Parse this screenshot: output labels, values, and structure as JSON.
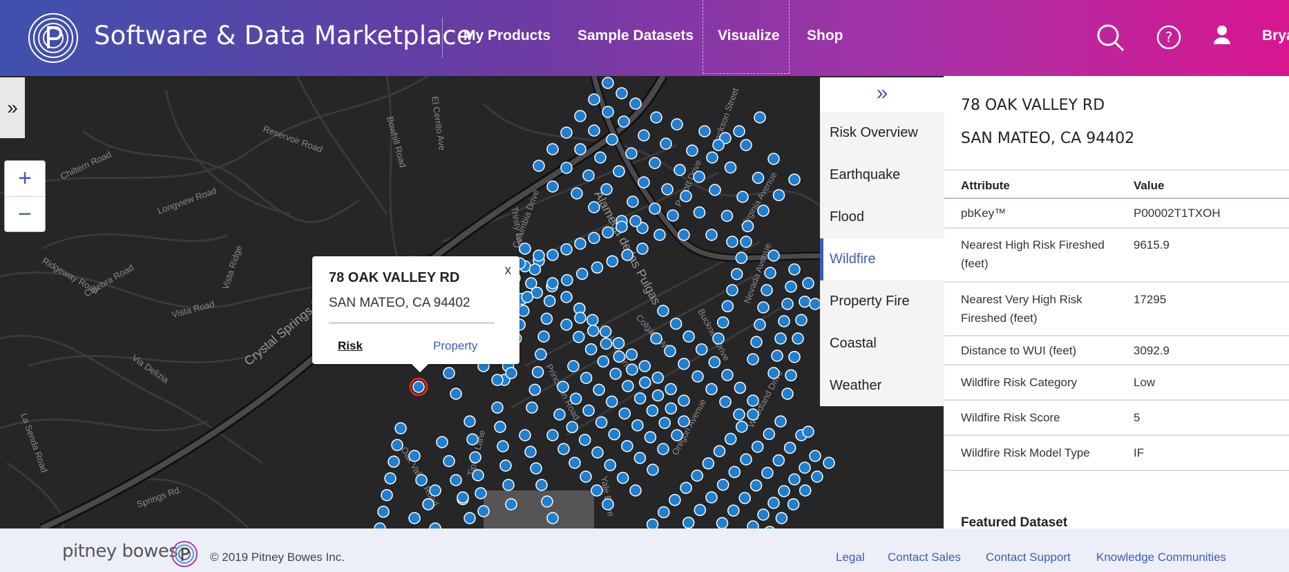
{
  "header": {
    "brand": "Software & Data Marketplace",
    "nav": [
      "My Products",
      "Sample Datasets",
      "Visualize",
      "Shop"
    ],
    "active_nav": "Visualize",
    "user": "Bryan"
  },
  "map": {
    "street_labels": [
      "Crystal Springs Rd.",
      "Alameda de las Pulgas",
      "Reservoir Road",
      "Chiltern Road",
      "Longview Road",
      "Ridgeway Road",
      "Culebra Road",
      "Vista Road",
      "Via Delizia",
      "La Senda Road",
      "Bowhill Road",
      "El Cerrito Ave",
      "Parrott Drive",
      "Virginia Avenue",
      "Jackson Street",
      "Columbia Drive",
      "Colgate Way",
      "Iowa Drive",
      "Princeton Road",
      "Yale Drive",
      "Oregon Avenue",
      "Woodland Drive",
      "Nevada Avenue",
      "Bucknell Drive",
      "Oak Valley Road",
      "Tiptoe Lane",
      "Vista Ridge",
      "Trinity Lane",
      "Springs Rd."
    ],
    "point_color": "#1f7fd0",
    "selected_color": "#d9262c"
  },
  "popup": {
    "title": "78 OAK VALLEY RD",
    "address": "SAN MATEO, CA 94402",
    "close": "x",
    "risk_link": "Risk",
    "property_link": "Property"
  },
  "side_tabs": [
    "Risk Overview",
    "Earthquake",
    "Flood",
    "Wildfire",
    "Property Fire",
    "Coastal",
    "Weather"
  ],
  "active_tab": "Wildfire",
  "panel": {
    "address_line1": "78 OAK VALLEY RD",
    "address_line2": "SAN MATEO, CA 94402",
    "header": {
      "attribute": "Attribute",
      "value": "Value"
    },
    "rows": [
      {
        "attribute": "pbKey™",
        "value": "P00002T1TXOH"
      },
      {
        "attribute": "Nearest High Risk Fireshed (feet)",
        "value": "9615.9"
      },
      {
        "attribute": "Nearest Very High Risk Fireshed (feet)",
        "value": "17295"
      },
      {
        "attribute": "Distance to WUI (feet)",
        "value": "3092.9"
      },
      {
        "attribute": "Wildfire Risk Category",
        "value": "Low"
      },
      {
        "attribute": "Wildfire Risk Score",
        "value": "5"
      },
      {
        "attribute": "Wildfire Risk Model Type",
        "value": "IF"
      }
    ],
    "featured": "Featured Dataset"
  },
  "footer": {
    "brand": "pitney bowes",
    "copyright": "© 2019 Pitney Bowes Inc.",
    "links": [
      "Legal",
      "Contact Sales",
      "Contact Support",
      "Knowledge Communities"
    ]
  },
  "colors": {
    "accent": "#3f5cb8",
    "header_start": "#3f51ad",
    "header_end": "#d81690"
  }
}
